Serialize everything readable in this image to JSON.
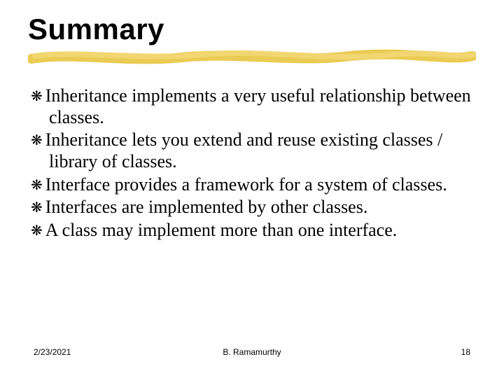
{
  "title": "Summary",
  "bullets": [
    "Inheritance implements a very useful relationship between classes.",
    "Inheritance lets you extend and reuse existing classes / library of classes.",
    "Interface provides a framework for a system of classes.",
    "Interfaces are implemented by other classes.",
    "A class may implement more than one interface."
  ],
  "footer": {
    "date": "2/23/2021",
    "author": "B. Ramamurthy",
    "page": "18"
  },
  "marker": "❋"
}
